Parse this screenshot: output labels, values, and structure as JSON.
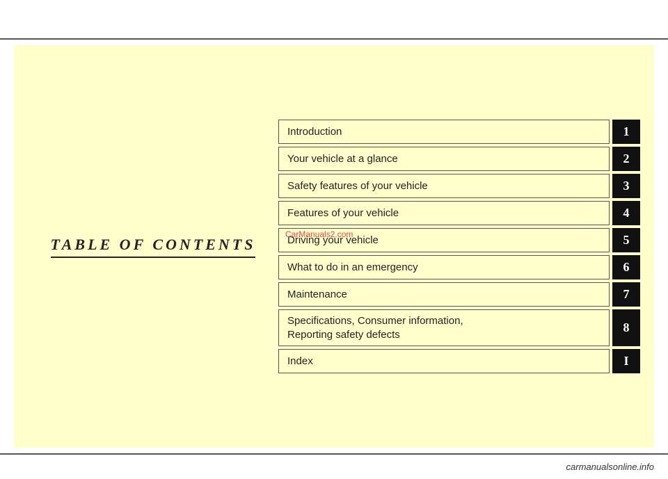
{
  "page": {
    "background_color": "#ffffff",
    "top_line_color": "#555555",
    "panel_bg": "#ffffcc"
  },
  "left": {
    "title": "TABLE OF CONTENTS"
  },
  "toc": {
    "items": [
      {
        "label": "Introduction",
        "number": "1"
      },
      {
        "label": "Your vehicle at a glance",
        "number": "2"
      },
      {
        "label": "Safety features of your vehicle",
        "number": "3"
      },
      {
        "label": "Features of your vehicle",
        "number": "4"
      },
      {
        "label": "Driving your vehicle",
        "number": "5"
      },
      {
        "label": "What to do in an emergency",
        "number": "6"
      },
      {
        "label": "Maintenance",
        "number": "7"
      },
      {
        "label": "Specifications, Consumer information,\nReporting safety defects",
        "number": "8"
      },
      {
        "label": "Index",
        "number": "I"
      }
    ]
  },
  "watermark": {
    "text": "CarManuals2.com"
  },
  "footer": {
    "text": "carmanualsonline.info"
  }
}
